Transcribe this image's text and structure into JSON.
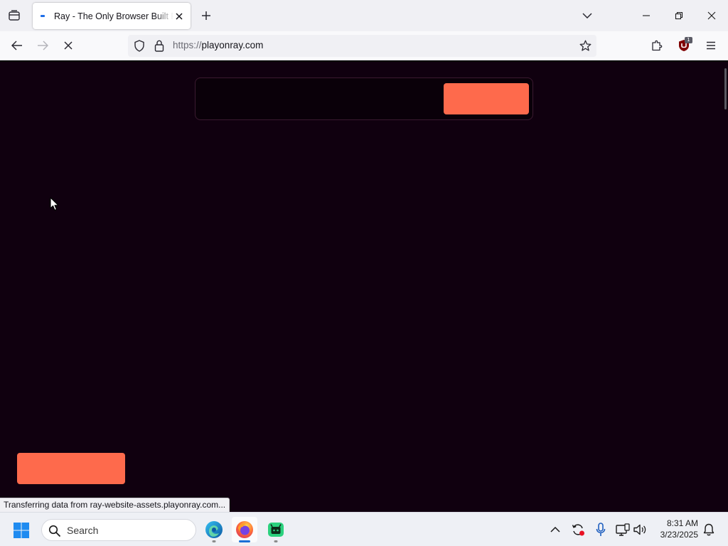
{
  "browser": {
    "tab": {
      "title": "Ray - The Only Browser Built For Gamers",
      "favicon": "ray-favicon-icon"
    },
    "url": {
      "scheme": "https://",
      "host": "playonray.com"
    },
    "extension_badge": "1"
  },
  "page": {
    "hero_cta_label": "",
    "bottom_cta_label": "",
    "accent_color": "#fe6a4c",
    "background_color": "#10000f"
  },
  "status_bar": {
    "text": "Transferring data from ray-website-assets.playonray.com..."
  },
  "taskbar": {
    "search_placeholder": "Search",
    "apps": [
      "edge-icon",
      "firefox-icon",
      "android-app-icon"
    ],
    "clock": {
      "time": "8:31 AM",
      "date": "3/23/2025"
    }
  }
}
